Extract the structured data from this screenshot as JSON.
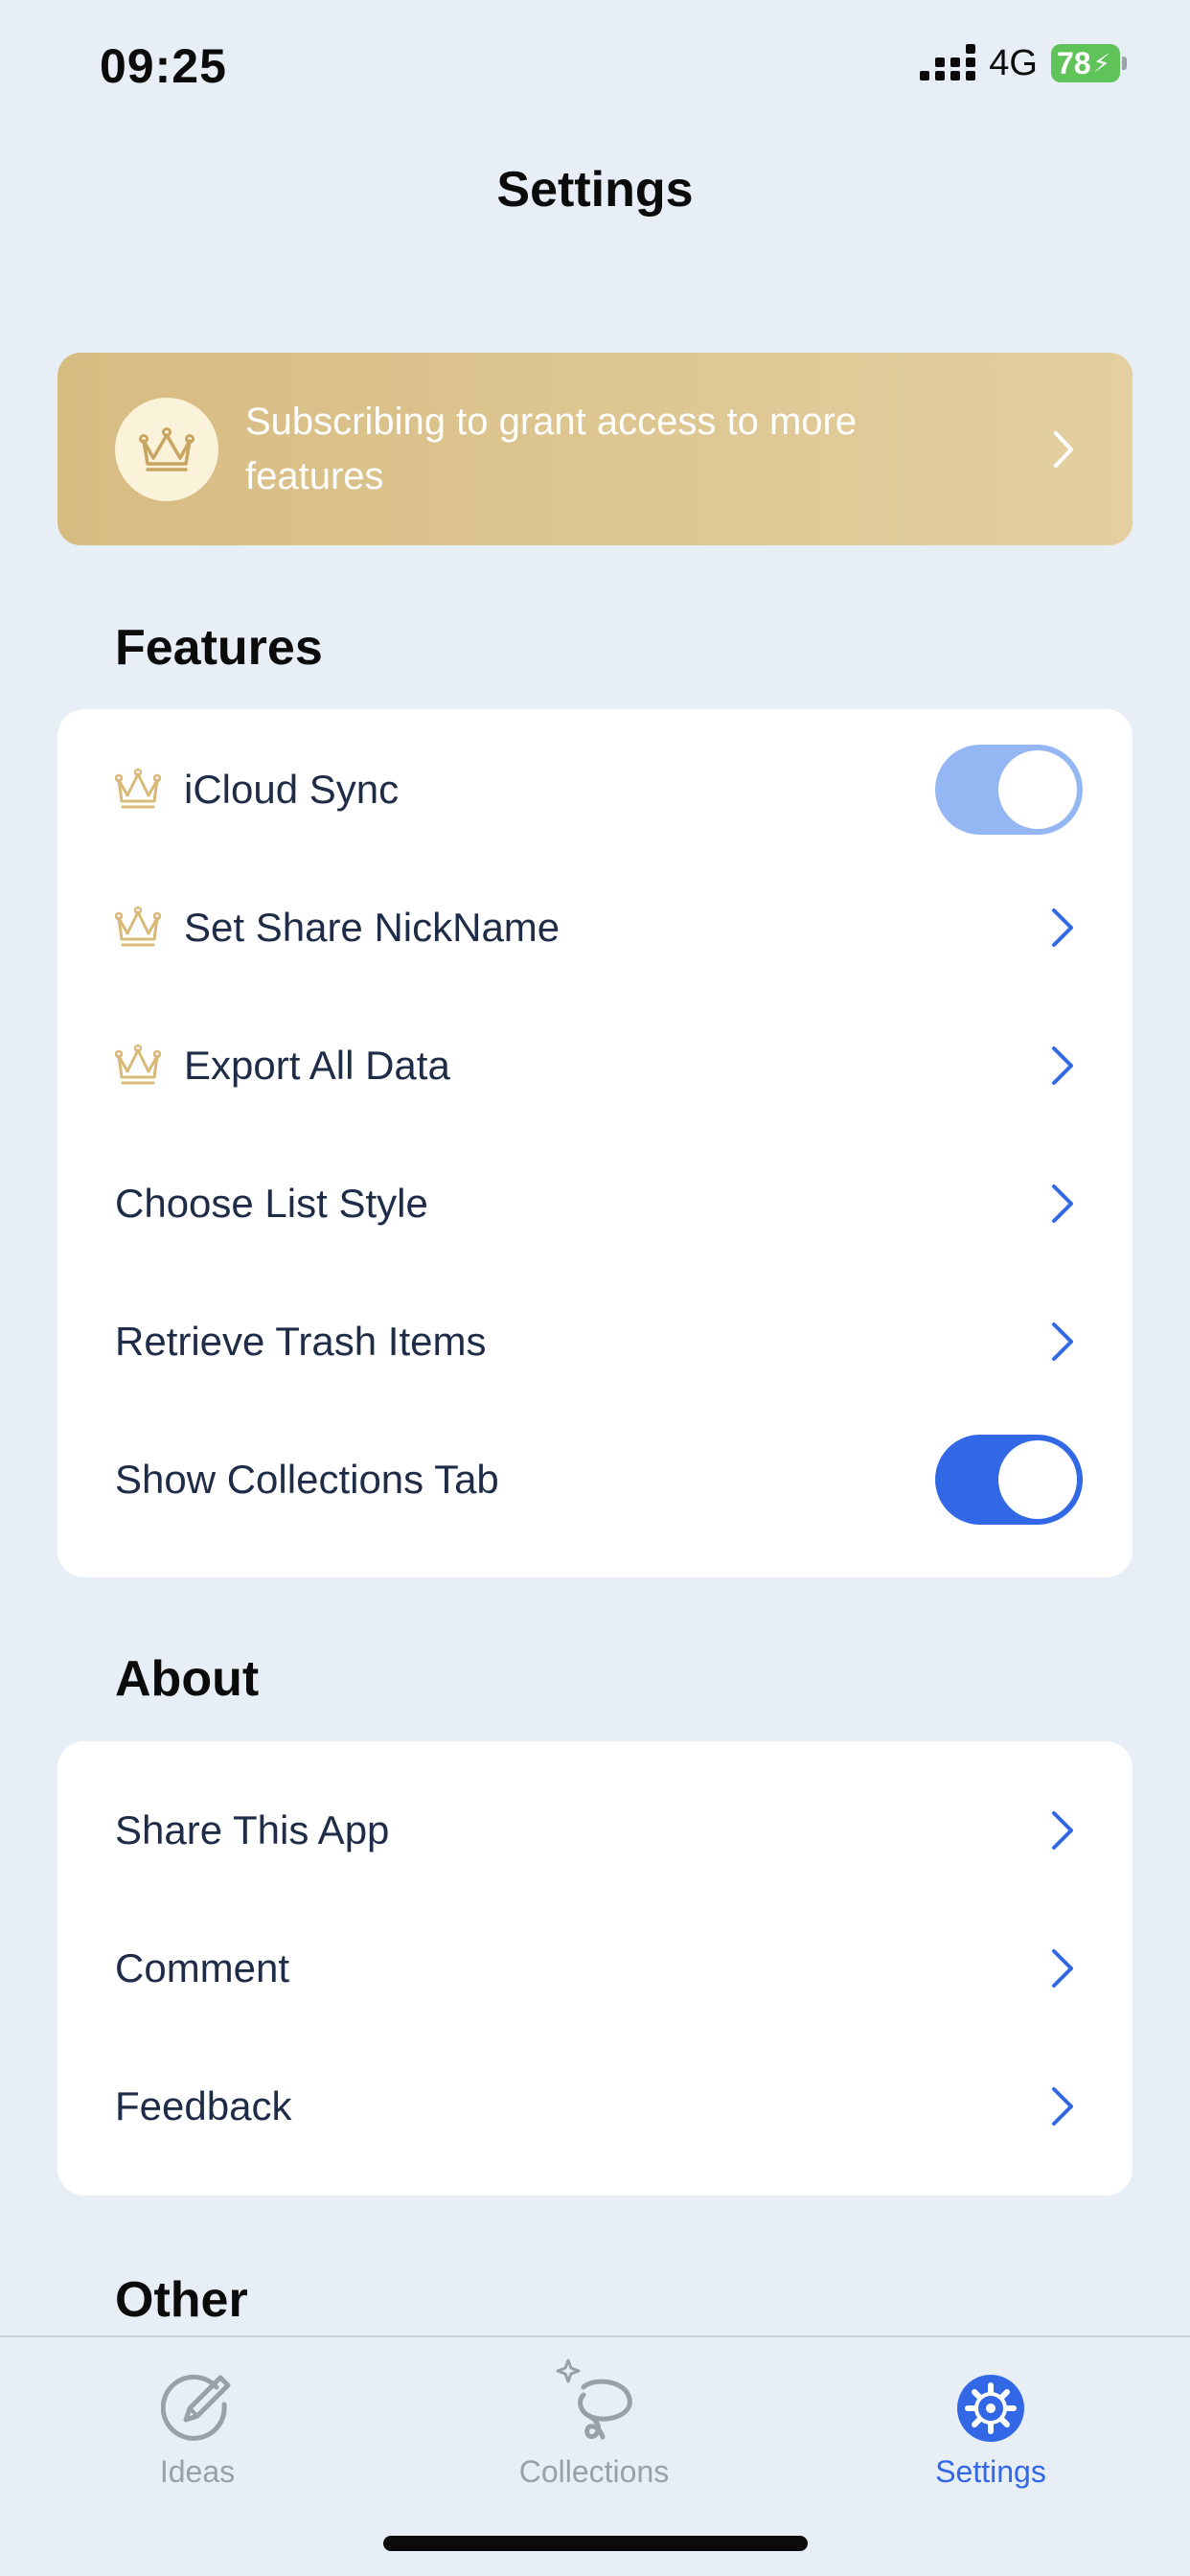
{
  "status_bar": {
    "time": "09:25",
    "network": "4G",
    "battery": "78"
  },
  "header": {
    "title": "Settings"
  },
  "banner": {
    "text": "Subscribing to grant access to more features",
    "icon": "crown-icon"
  },
  "features": {
    "title": "Features",
    "items": [
      {
        "label": "iCloud Sync",
        "premium": true,
        "control": "toggle",
        "toggle_on": true,
        "toggle_disabled": true
      },
      {
        "label": "Set Share NickName",
        "premium": true,
        "control": "chevron"
      },
      {
        "label": "Export All Data",
        "premium": true,
        "control": "chevron"
      },
      {
        "label": "Choose List Style",
        "premium": false,
        "control": "chevron"
      },
      {
        "label": "Retrieve Trash Items",
        "premium": false,
        "control": "chevron"
      },
      {
        "label": "Show Collections Tab",
        "premium": false,
        "control": "toggle",
        "toggle_on": true
      }
    ]
  },
  "about": {
    "title": "About",
    "items": [
      {
        "label": "Share This App",
        "control": "chevron"
      },
      {
        "label": "Comment",
        "control": "chevron"
      },
      {
        "label": "Feedback",
        "control": "chevron"
      }
    ]
  },
  "other": {
    "title": "Other"
  },
  "tabbar": {
    "tabs": [
      {
        "label": "Ideas",
        "icon": "pencil-circle-icon",
        "active": false
      },
      {
        "label": "Collections",
        "icon": "sparkle-lasso-icon",
        "active": false
      },
      {
        "label": "Settings",
        "icon": "gear-icon",
        "active": true
      }
    ]
  },
  "colors": {
    "background": "#e8eef5",
    "accent": "#3268e6",
    "accent_disabled": "#94b6f2",
    "gold": "#d8b97a",
    "text": "#1e2c48",
    "battery": "#5fc35a"
  }
}
